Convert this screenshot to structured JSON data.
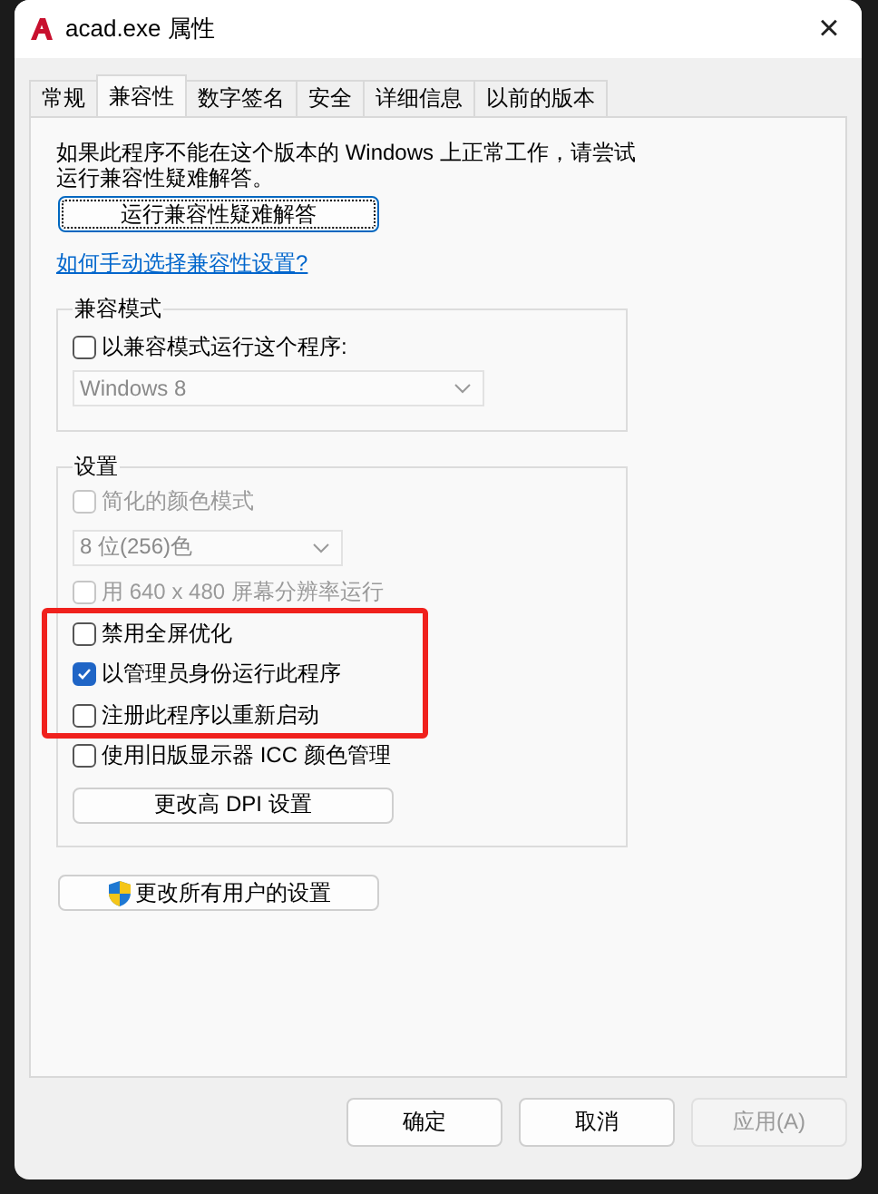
{
  "window": {
    "title": "acad.exe 属性",
    "close": "×"
  },
  "tabs": [
    {
      "label": "常规",
      "selected": false
    },
    {
      "label": "兼容性",
      "selected": true
    },
    {
      "label": "数字签名",
      "selected": false
    },
    {
      "label": "安全",
      "selected": false
    },
    {
      "label": "详细信息",
      "selected": false
    },
    {
      "label": "以前的版本",
      "selected": false
    }
  ],
  "intro": "如果此程序不能在这个版本的 Windows 上正常工作，请尝试运行兼容性疑难解答。",
  "troubleshoot_button": "运行兼容性疑难解答",
  "help_link": "如何手动选择兼容性设置?",
  "compat_mode": {
    "title": "兼容模式",
    "checkbox": {
      "label": "以兼容模式运行这个程序:",
      "checked": false
    },
    "dropdown": {
      "value": "Windows 8",
      "disabled": true
    }
  },
  "settings": {
    "title": "设置",
    "items": [
      {
        "kind": "checkbox",
        "label": "简化的颜色模式",
        "checked": false,
        "disabled": true
      },
      {
        "kind": "dropdown",
        "value": "8 位(256)色",
        "disabled": true
      },
      {
        "kind": "checkbox",
        "label": "用 640 x 480 屏幕分辨率运行",
        "checked": false,
        "disabled": true
      },
      {
        "kind": "checkbox",
        "label": "禁用全屏优化",
        "checked": false,
        "disabled": false
      },
      {
        "kind": "checkbox",
        "label": "以管理员身份运行此程序",
        "checked": true,
        "disabled": false
      },
      {
        "kind": "checkbox",
        "label": "注册此程序以重新启动",
        "checked": false,
        "disabled": false
      },
      {
        "kind": "checkbox",
        "label": "使用旧版显示器 ICC 颜色管理",
        "checked": false,
        "disabled": false
      },
      {
        "kind": "button",
        "label": "更改高 DPI 设置"
      }
    ]
  },
  "all_users_button": "更改所有用户的设置",
  "buttons": [
    {
      "label": "确定",
      "disabled": false
    },
    {
      "label": "取消",
      "disabled": false
    },
    {
      "label": "应用(A)",
      "disabled": true
    }
  ]
}
